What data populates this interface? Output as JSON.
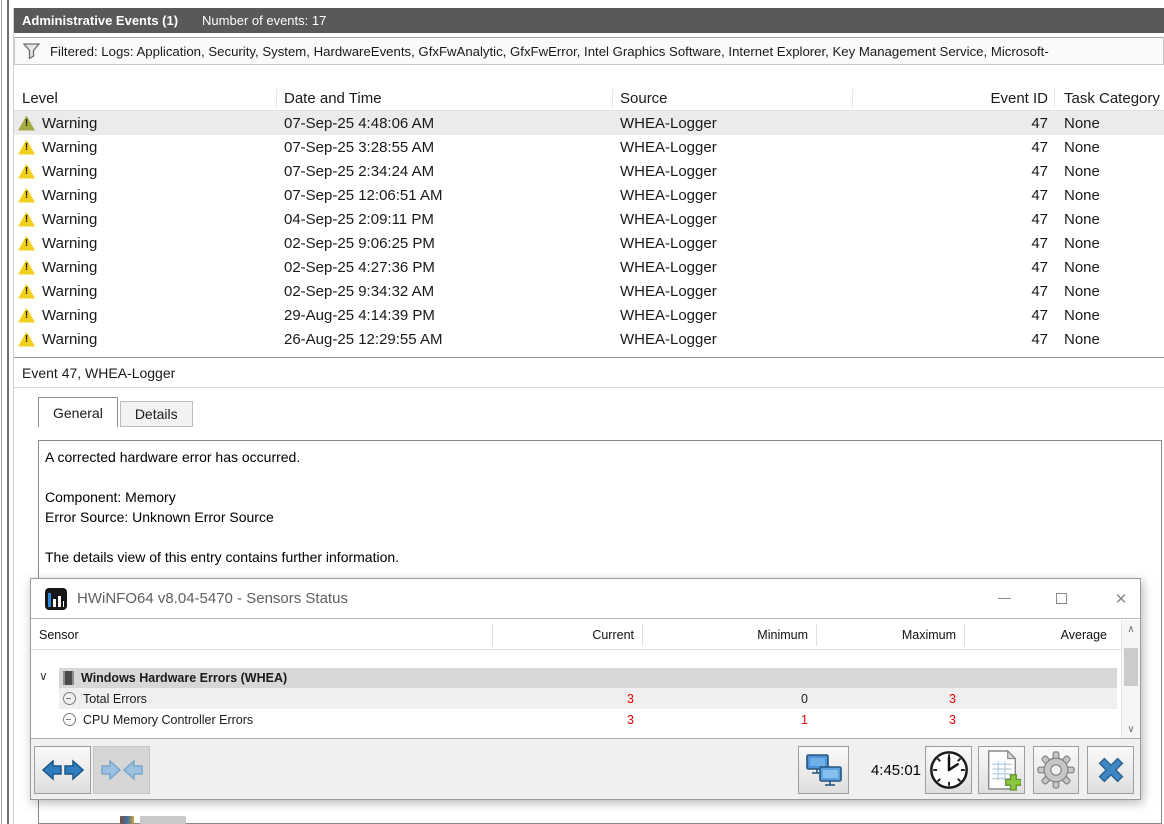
{
  "event_viewer": {
    "header": {
      "title": "Administrative Events (1)",
      "events_count": "Number of events: 17"
    },
    "filter": {
      "text": "Filtered: Logs: Application, Security, System, HardwareEvents, GfxFwAnalytic, GfxFwError, Intel Graphics Software, Internet Explorer, Key Management Service, Microsoft-"
    },
    "table": {
      "columns": {
        "level": "Level",
        "datetime": "Date and Time",
        "source": "Source",
        "event_id": "Event ID",
        "task_category": "Task Category"
      },
      "rows": [
        {
          "level": "Warning",
          "datetime": "07-Sep-25 4:48:06 AM",
          "source": "WHEA-Logger",
          "event_id": "47",
          "task_category": "None"
        },
        {
          "level": "Warning",
          "datetime": "07-Sep-25 3:28:55 AM",
          "source": "WHEA-Logger",
          "event_id": "47",
          "task_category": "None"
        },
        {
          "level": "Warning",
          "datetime": "07-Sep-25 2:34:24 AM",
          "source": "WHEA-Logger",
          "event_id": "47",
          "task_category": "None"
        },
        {
          "level": "Warning",
          "datetime": "07-Sep-25 12:06:51 AM",
          "source": "WHEA-Logger",
          "event_id": "47",
          "task_category": "None"
        },
        {
          "level": "Warning",
          "datetime": "04-Sep-25 2:09:11 PM",
          "source": "WHEA-Logger",
          "event_id": "47",
          "task_category": "None"
        },
        {
          "level": "Warning",
          "datetime": "02-Sep-25 9:06:25 PM",
          "source": "WHEA-Logger",
          "event_id": "47",
          "task_category": "None"
        },
        {
          "level": "Warning",
          "datetime": "02-Sep-25 4:27:36 PM",
          "source": "WHEA-Logger",
          "event_id": "47",
          "task_category": "None"
        },
        {
          "level": "Warning",
          "datetime": "02-Sep-25 9:34:32 AM",
          "source": "WHEA-Logger",
          "event_id": "47",
          "task_category": "None"
        },
        {
          "level": "Warning",
          "datetime": "29-Aug-25 4:14:39 PM",
          "source": "WHEA-Logger",
          "event_id": "47",
          "task_category": "None"
        },
        {
          "level": "Warning",
          "datetime": "26-Aug-25 12:29:55 AM",
          "source": "WHEA-Logger",
          "event_id": "47",
          "task_category": "None"
        }
      ]
    },
    "detail": {
      "title": "Event 47, WHEA-Logger",
      "tab_general": "General",
      "tab_details": "Details",
      "description": {
        "line1": "A corrected hardware error has occurred.",
        "line2": "Component: Memory",
        "line3": "Error Source: Unknown Error Source",
        "line4": "The details view of this entry contains further information."
      }
    },
    "colors": {
      "header_bar": "#595959",
      "warning_yellow": "#f2cf1c",
      "selected_row": "#ebebeb"
    }
  },
  "hwinfo": {
    "window_title": "HWiNFO64 v8.04-5470 - Sensors Status",
    "columns": {
      "sensor": "Sensor",
      "current": "Current",
      "minimum": "Minimum",
      "maximum": "Maximum",
      "average": "Average"
    },
    "group_label": "Windows Hardware Errors (WHEA)",
    "sensors": [
      {
        "name": "Total Errors",
        "current": "3",
        "minimum": "0",
        "maximum": "3",
        "average": ""
      },
      {
        "name": "CPU Memory Controller Errors",
        "current": "3",
        "minimum": "1",
        "maximum": "3",
        "average": ""
      }
    ],
    "toolbar": {
      "time": "4:45:01"
    },
    "colors": {
      "value_red": "#e60000",
      "accent_blue": "#3e87c4"
    }
  },
  "icons": {
    "scroll_up": "∧",
    "scroll_down": "∨",
    "group_chevron": "∨",
    "window_close": "✕"
  }
}
